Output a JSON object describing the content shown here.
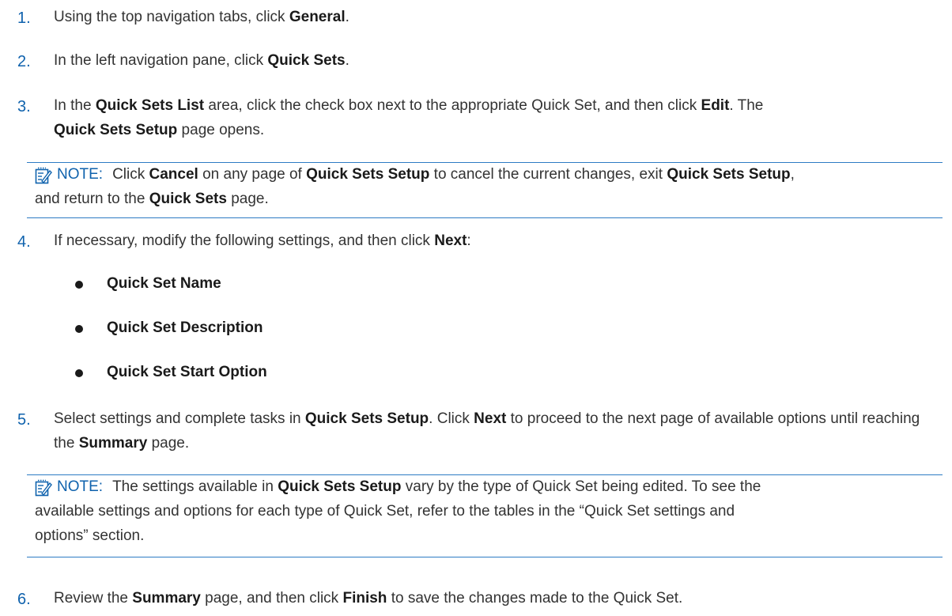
{
  "steps": [
    {
      "num": "1.",
      "parts": [
        "Using the top navigation tabs, click ",
        "General",
        "."
      ]
    },
    {
      "num": "2.",
      "parts": [
        "In the left navigation pane, click ",
        "Quick Sets",
        "."
      ]
    },
    {
      "num": "3.",
      "parts": [
        "In the ",
        "Quick Sets List",
        " area, click the check box next to the appropriate Quick Set, and then click ",
        "Edit",
        ". The",
        "Quick Sets Setup",
        " page opens."
      ]
    },
    {
      "num": "4.",
      "parts": [
        "If necessary, modify the following settings, and then click ",
        "Next",
        ":"
      ]
    },
    {
      "num": "5.",
      "parts": [
        "Select settings and complete tasks in ",
        "Quick Sets Setup",
        ". Click ",
        "Next",
        " to proceed to the next page of available options until reaching the ",
        "Summary",
        " page."
      ]
    },
    {
      "num": "6.",
      "parts": [
        "Review the ",
        "Summary",
        " page, and then click ",
        "Finish",
        " to save the changes made to the Quick Set."
      ]
    }
  ],
  "notes": [
    {
      "label": "NOTE:",
      "parts": [
        "Click ",
        "Cancel",
        " on any page of ",
        "Quick Sets Setup",
        " to cancel the current changes, exit ",
        "Quick Sets Setup",
        ",",
        "and return to the ",
        "Quick Sets",
        " page."
      ]
    },
    {
      "label": "NOTE:",
      "parts": [
        "The settings available in ",
        "Quick Sets Setup",
        " vary by the type of Quick Set being edited. To see the",
        "available settings and options for each type of Quick Set, refer to the tables in the “Quick Set settings and",
        "options” section."
      ]
    }
  ],
  "bullets": [
    "Quick Set Name",
    "Quick Set Description",
    "Quick Set Start Option"
  ],
  "icons": {
    "note": "note-pencil-icon"
  },
  "colors": {
    "accent": "#0f62ad",
    "rule": "#2d7bc4"
  }
}
